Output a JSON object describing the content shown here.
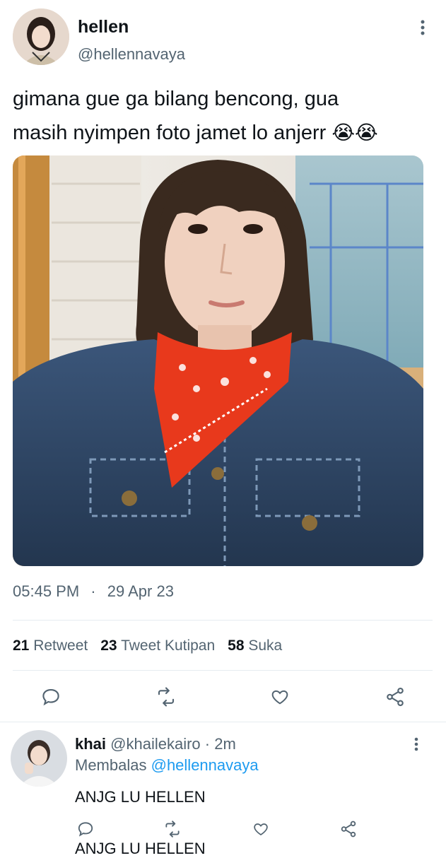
{
  "tweet": {
    "author_name": "hellen",
    "author_handle": "@hellennavaya",
    "text_line1": "gimana gue ga bilang bencong, gua",
    "text_line2": "masih nyimpen foto jamet lo anjerr",
    "emoji": "😭😭",
    "time": "05:45 PM",
    "dot": "·",
    "date": "29 Apr 23",
    "stats": {
      "retweets_count": "21",
      "retweets_label": "Retweet",
      "quotes_count": "23",
      "quotes_label": "Tweet Kutipan",
      "likes_count": "58",
      "likes_label": "Suka"
    },
    "actions": [
      "reply-icon",
      "retweet-icon",
      "like-icon",
      "share-icon"
    ]
  },
  "reply": {
    "author_name": "khai",
    "author_handle": "@khailekairo",
    "separator": "·",
    "time": "2m",
    "replying_prefix": "Membalas",
    "replying_to": "@hellennavaya",
    "text": "ANJG LU HELLEN",
    "cut_off_text": "ANJG LU HELLEN"
  },
  "colors": {
    "accent": "#1d9bf0",
    "muted": "#536471",
    "scarf": "#e8391c",
    "denim": "#2e4766"
  }
}
